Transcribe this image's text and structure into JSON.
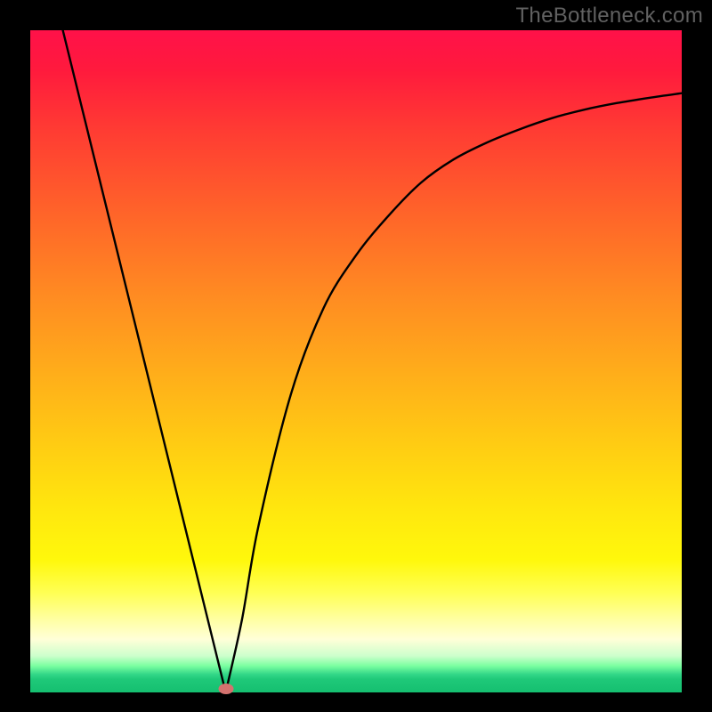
{
  "watermark": "TheBottleneck.com",
  "chart_data": {
    "type": "line",
    "title": "",
    "xlabel": "",
    "ylabel": "",
    "xlim": [
      0,
      100
    ],
    "ylim": [
      0,
      100
    ],
    "grid": false,
    "series": [
      {
        "name": "curve",
        "x": [
          5,
          10,
          15,
          20,
          25,
          27.5,
          30,
          32.5,
          35,
          40,
          45,
          50,
          55,
          60,
          65,
          70,
          75,
          80,
          85,
          90,
          95,
          100
        ],
        "y": [
          100,
          80,
          60,
          40,
          20,
          10,
          0,
          11,
          25,
          45,
          58,
          66,
          72,
          77,
          80.5,
          83,
          85,
          86.7,
          88,
          89,
          89.8,
          90.5
        ]
      }
    ],
    "marker": {
      "x": 30,
      "y": 0.5,
      "color": "#d4726f"
    },
    "background_gradient": {
      "direction": "vertical",
      "stops": [
        {
          "pos": 0,
          "color": "#ff1149"
        },
        {
          "pos": 50,
          "color": "#ffb018"
        },
        {
          "pos": 80,
          "color": "#fff80c"
        },
        {
          "pos": 100,
          "color": "#15bf70"
        }
      ]
    }
  },
  "colors": {
    "curve": "#000000",
    "frame": "#000000",
    "marker": "#d4726f"
  }
}
